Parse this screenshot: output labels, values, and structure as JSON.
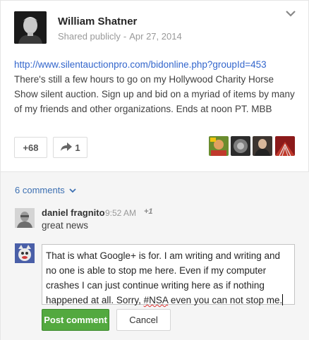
{
  "post": {
    "author": "William Shatner",
    "visibility": "Shared publicly",
    "separator": "-",
    "date": "Apr 27, 2014",
    "link": "http://www.silentauctionpro.com/bidonline.php?groupId=453",
    "text": " There's still a few hours to go on my Hollywood Charity Horse Show silent auction. Sign up and bid on a myriad of items by many of my friends and other organizations. Ends at noon PT. MBB",
    "plus_count": "+68",
    "share_count": "1",
    "menu_icon": "chevron-down-icon",
    "plusser_icons": [
      "plusser-avatar-1",
      "plusser-avatar-2",
      "plusser-avatar-3",
      "plusser-avatar-4"
    ]
  },
  "comments": {
    "toggle_label": "6 comments",
    "items": [
      {
        "author": "daniel fragnito",
        "time": "9:52 AM",
        "plus": "+1",
        "text": "great news"
      }
    ]
  },
  "composer": {
    "text_part1": "That is what Google+ is for. I am writing and writing and no one is able to stop me here. Even if my computer crashes I can just continue writing here as if nothing happened at all. Sorry, ",
    "text_misspelled": "#NSA",
    "text_part2": " even you can not stop me.",
    "post_label": "Post comment",
    "cancel_label": "Cancel"
  },
  "colors": {
    "link": "#3366cc",
    "accent_green": "#53a93f",
    "comments_bg": "#f5f5f5"
  }
}
